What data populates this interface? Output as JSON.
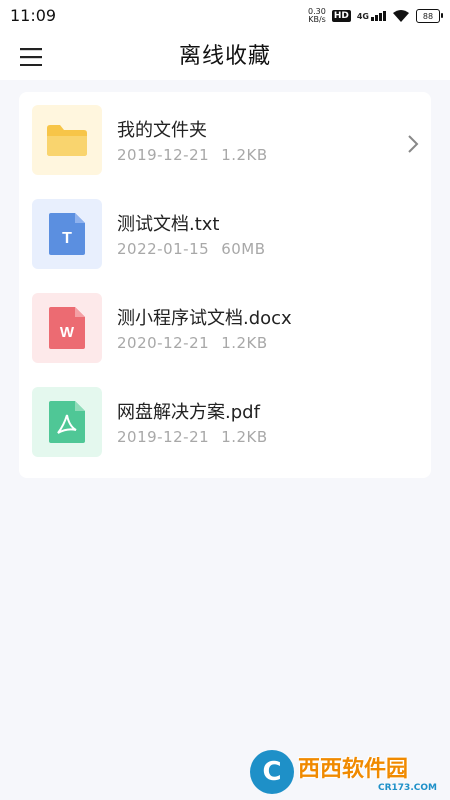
{
  "status_bar": {
    "time": "11:09",
    "net_speed_value": "0.30",
    "net_speed_unit": "KB/s",
    "hd_label": "HD",
    "network_label": "4G",
    "battery_level": "88"
  },
  "header": {
    "title": "离线收藏"
  },
  "files": [
    {
      "name": "我的文件夹",
      "date": "2019-12-21",
      "size": "1.2KB",
      "icon": "folder-icon",
      "icon_color": "#f5c34a",
      "icon_bg": "#fff6de"
    },
    {
      "name": "测试文档.txt",
      "date": "2022-01-15",
      "size": "60MB",
      "icon": "txt-file-icon",
      "icon_letter": "T",
      "icon_color": "#5b8fe0",
      "icon_bg": "#e8effd"
    },
    {
      "name": "测小程序试文档.docx",
      "date": "2020-12-21",
      "size": "1.2KB",
      "icon": "word-file-icon",
      "icon_letter": "W",
      "icon_color": "#ec6b72",
      "icon_bg": "#fde9ea"
    },
    {
      "name": "网盘解决方案.pdf",
      "date": "2019-12-21",
      "size": "1.2KB",
      "icon": "pdf-file-icon",
      "icon_color": "#4fc796",
      "icon_bg": "#e4f8ee"
    }
  ],
  "watermark": {
    "brand": "西西软件园",
    "domain": "CR173.COM"
  }
}
